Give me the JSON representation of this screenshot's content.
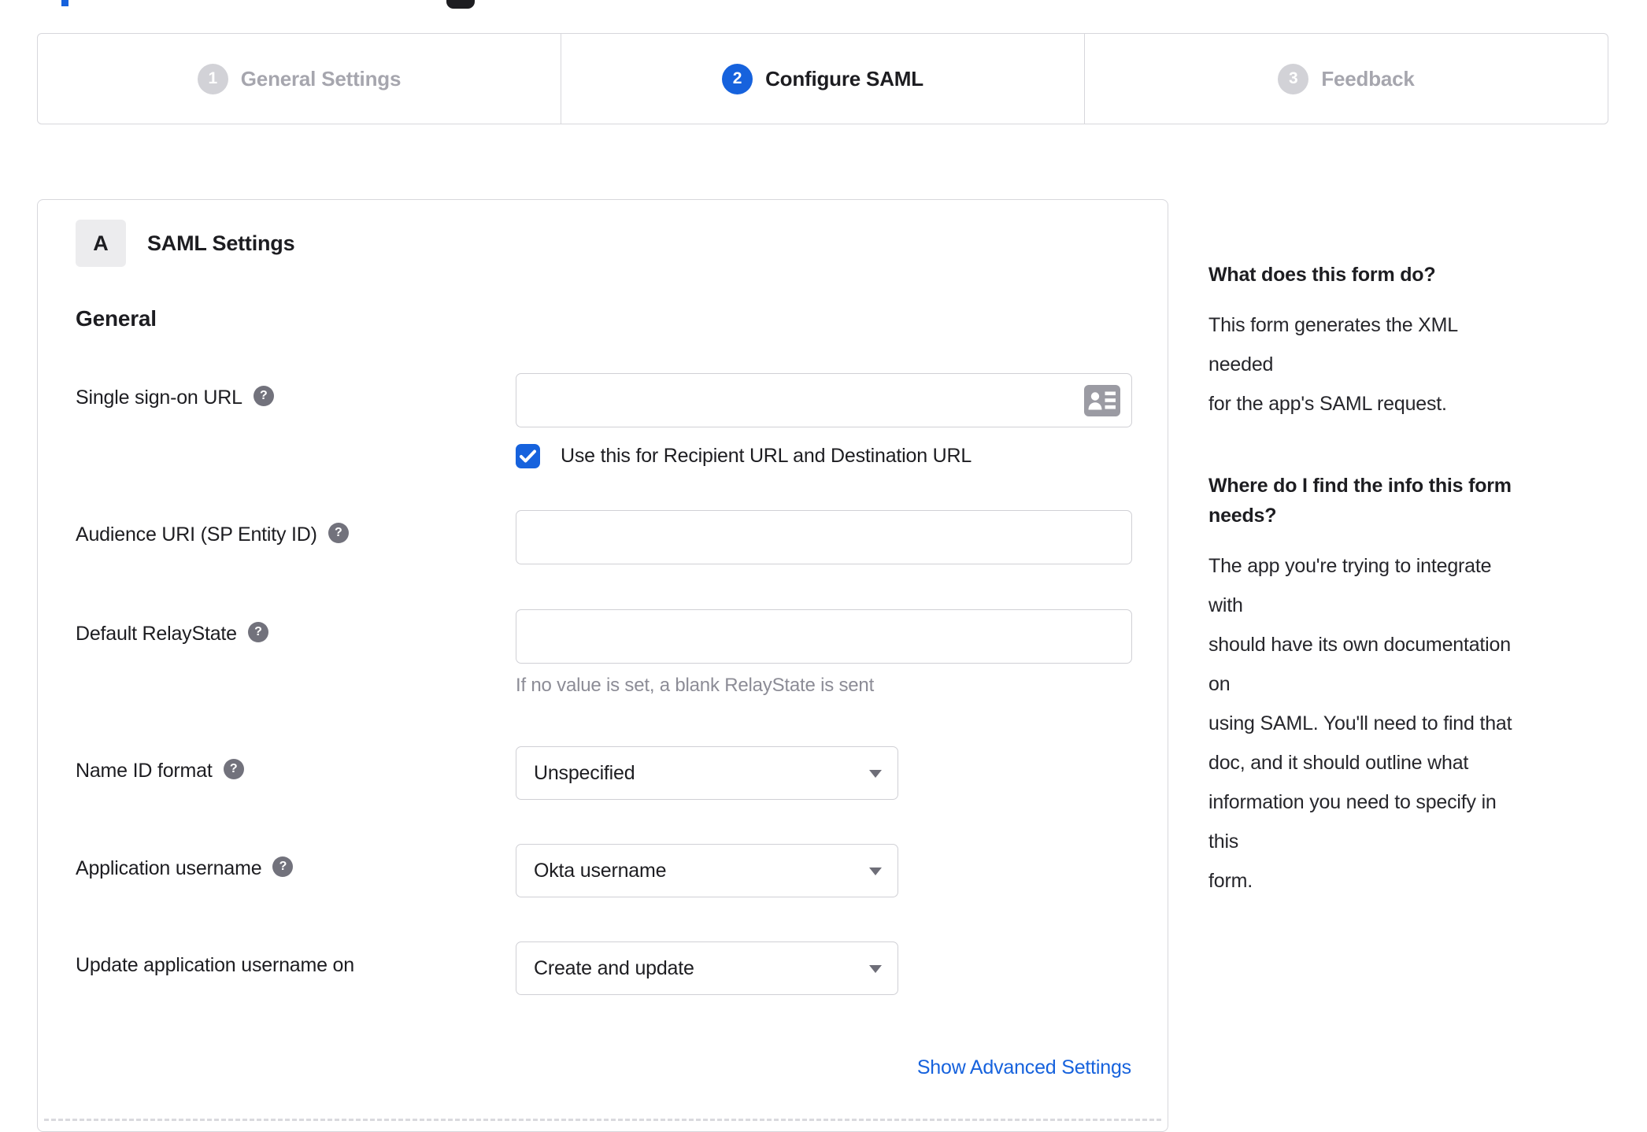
{
  "colors": {
    "accent": "#1662dd",
    "text": "#1d1d21",
    "muted_text": "#8c8c96",
    "inactive_step": "#a6a6ae",
    "border": "#d7d7dc"
  },
  "stepper": {
    "steps": [
      {
        "number": "1",
        "label": "General Settings",
        "state": "inactive"
      },
      {
        "number": "2",
        "label": "Configure SAML",
        "state": "active"
      },
      {
        "number": "3",
        "label": "Feedback",
        "state": "inactive"
      }
    ]
  },
  "panel": {
    "badge": "A",
    "title": "SAML Settings",
    "section_title": "General",
    "fields": [
      {
        "label": "Single sign-on URL",
        "type": "text",
        "value": "",
        "has_help": true,
        "checkbox": {
          "checked": true,
          "label": "Use this for Recipient URL and Destination URL"
        }
      },
      {
        "label": "Audience URI (SP Entity ID)",
        "type": "text",
        "value": "",
        "has_help": true
      },
      {
        "label": "Default RelayState",
        "type": "text",
        "value": "",
        "has_help": true,
        "helper": "If no value is set, a blank RelayState is sent"
      },
      {
        "label": "Name ID format",
        "type": "select",
        "value": "Unspecified",
        "has_help": true
      },
      {
        "label": "Application username",
        "type": "select",
        "value": "Okta username",
        "has_help": true
      },
      {
        "label": "Update application username on",
        "type": "select",
        "value": "Create and update",
        "has_help": false
      }
    ],
    "advanced_link": "Show Advanced Settings"
  },
  "sidebar": {
    "sections": [
      {
        "heading_lines": [
          "What does this form do?"
        ],
        "body_lines": [
          "This form generates the XML needed",
          "for the app's SAML request."
        ]
      },
      {
        "heading_lines": [
          "Where do I find the info this form",
          "needs?"
        ],
        "body_lines": [
          "The app you're trying to integrate with",
          "should have its own documentation on",
          "using SAML. You'll need to find that",
          "doc, and it should outline what",
          "information you need to specify in this",
          "form."
        ]
      }
    ]
  }
}
